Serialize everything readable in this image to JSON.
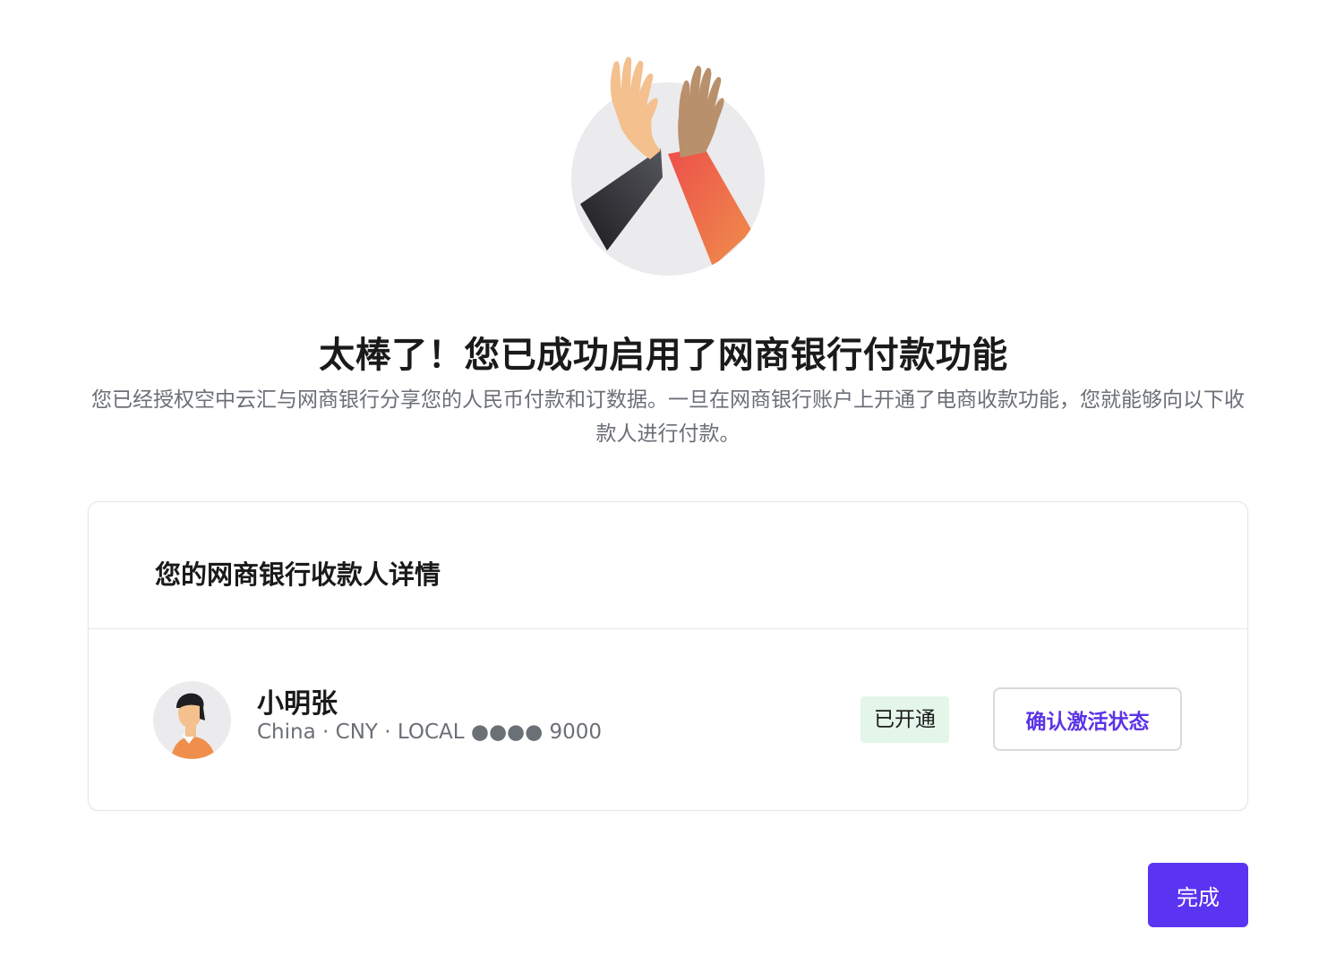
{
  "hero": {
    "icon": "high-five-illustration"
  },
  "header": {
    "title": "太棒了！您已成功启用了网商银行付款功能",
    "subtitle": "您已经授权空中云汇与网商银行分享您的人民币付款和订数据。一旦在网商银行账户上开通了电商收款功能，您就能够向以下收款人进行付款。"
  },
  "card": {
    "title": "您的网商银行收款人详情",
    "payee": {
      "name": "小明张",
      "meta": "China · CNY · LOCAL ●●●● 9000",
      "status": "已开通",
      "confirm_label": "确认激活状态",
      "avatar_icon": "person-avatar-icon"
    }
  },
  "footer": {
    "done_label": "完成"
  },
  "colors": {
    "accent": "#5b34f2",
    "badge_bg": "#e4f5e9",
    "muted_text": "#6b6f76",
    "border": "#e5e6ea"
  }
}
